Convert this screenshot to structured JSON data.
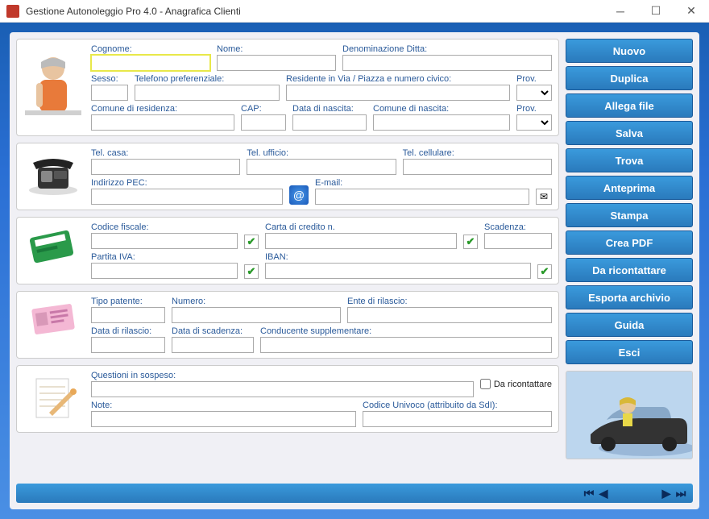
{
  "window": {
    "title": "Gestione Autonoleggio Pro 4.0 - Anagrafica Clienti"
  },
  "panels": {
    "personal": {
      "cognome": {
        "label": "Cognome:",
        "value": ""
      },
      "nome": {
        "label": "Nome:",
        "value": ""
      },
      "denominazione": {
        "label": "Denominazione Ditta:",
        "value": ""
      },
      "sesso": {
        "label": "Sesso:",
        "value": ""
      },
      "telefono_pref": {
        "label": "Telefono preferenziale:",
        "value": ""
      },
      "residente": {
        "label": "Residente in Via / Piazza e numero civico:",
        "value": ""
      },
      "prov1": {
        "label": "Prov.",
        "value": ""
      },
      "comune_res": {
        "label": "Comune di residenza:",
        "value": ""
      },
      "cap": {
        "label": "CAP:",
        "value": ""
      },
      "data_nascita": {
        "label": "Data di nascita:",
        "value": ""
      },
      "comune_nascita": {
        "label": "Comune di nascita:",
        "value": ""
      },
      "prov2": {
        "label": "Prov.",
        "value": ""
      }
    },
    "contact": {
      "tel_casa": {
        "label": "Tel. casa:",
        "value": ""
      },
      "tel_ufficio": {
        "label": "Tel. ufficio:",
        "value": ""
      },
      "tel_cell": {
        "label": "Tel. cellulare:",
        "value": ""
      },
      "pec": {
        "label": "Indirizzo PEC:",
        "value": ""
      },
      "email": {
        "label": "E-mail:",
        "value": ""
      }
    },
    "fiscal": {
      "codice_fiscale": {
        "label": "Codice fiscale:",
        "value": ""
      },
      "carta_credito": {
        "label": "Carta di credito n.",
        "value": ""
      },
      "scadenza": {
        "label": "Scadenza:",
        "value": ""
      },
      "partita_iva": {
        "label": "Partita IVA:",
        "value": ""
      },
      "iban": {
        "label": "IBAN:",
        "value": ""
      }
    },
    "license": {
      "tipo_patente": {
        "label": "Tipo patente:",
        "value": ""
      },
      "numero": {
        "label": "Numero:",
        "value": ""
      },
      "ente": {
        "label": "Ente di rilascio:",
        "value": ""
      },
      "data_rilascio": {
        "label": "Data di rilascio:",
        "value": ""
      },
      "data_scadenza": {
        "label": "Data di scadenza:",
        "value": ""
      },
      "conducente_supp": {
        "label": "Conducente supplementare:",
        "value": ""
      }
    },
    "notes": {
      "questioni": {
        "label": "Questioni in sospeso:",
        "value": ""
      },
      "da_ricontattare_chk": {
        "label": "Da ricontattare",
        "checked": false
      },
      "note": {
        "label": "Note:",
        "value": ""
      },
      "codice_univoco": {
        "label": "Codice Univoco (attribuito da SdI):",
        "value": ""
      }
    }
  },
  "buttons": {
    "nuovo": "Nuovo",
    "duplica": "Duplica",
    "allega": "Allega file",
    "salva": "Salva",
    "trova": "Trova",
    "anteprima": "Anteprima",
    "stampa": "Stampa",
    "crea_pdf": "Crea PDF",
    "da_ricontattare": "Da ricontattare",
    "esporta": "Esporta archivio",
    "guida": "Guida",
    "esci": "Esci"
  }
}
